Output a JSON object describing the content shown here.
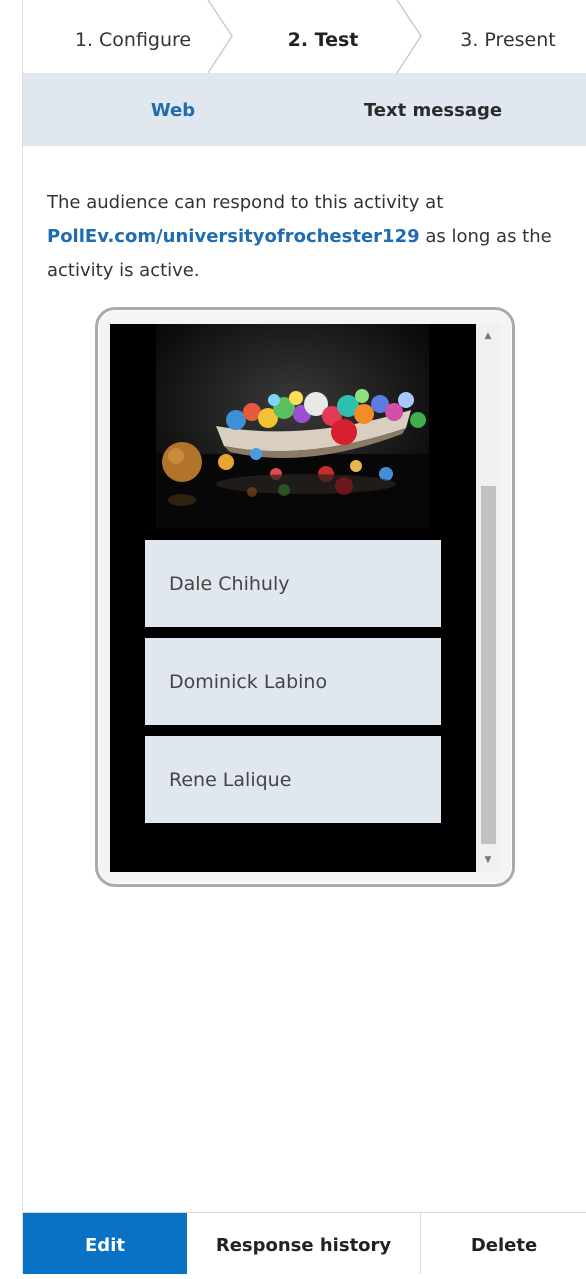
{
  "steps": [
    {
      "label": "1. Configure"
    },
    {
      "label": "2. Test"
    },
    {
      "label": "3. Present"
    }
  ],
  "tabs": [
    {
      "label": "Web"
    },
    {
      "label": "Text message"
    }
  ],
  "intro": {
    "before_link": "The audience can respond to this activity at ",
    "link": "PollEv.com/universityofrochester129",
    "after_link": " as long as the activity is active."
  },
  "preview": {
    "image_icon": "glass-boats-photo",
    "options": [
      {
        "label": "Dale Chihuly"
      },
      {
        "label": "Dominick Labino"
      },
      {
        "label": "Rene Lalique"
      }
    ]
  },
  "actions": {
    "edit": "Edit",
    "history": "Response history",
    "delete": "Delete"
  },
  "colors": {
    "accent": "#1f6cb0",
    "edit_button": "#0a72c4",
    "tab_bg": "#e1e7ef"
  }
}
